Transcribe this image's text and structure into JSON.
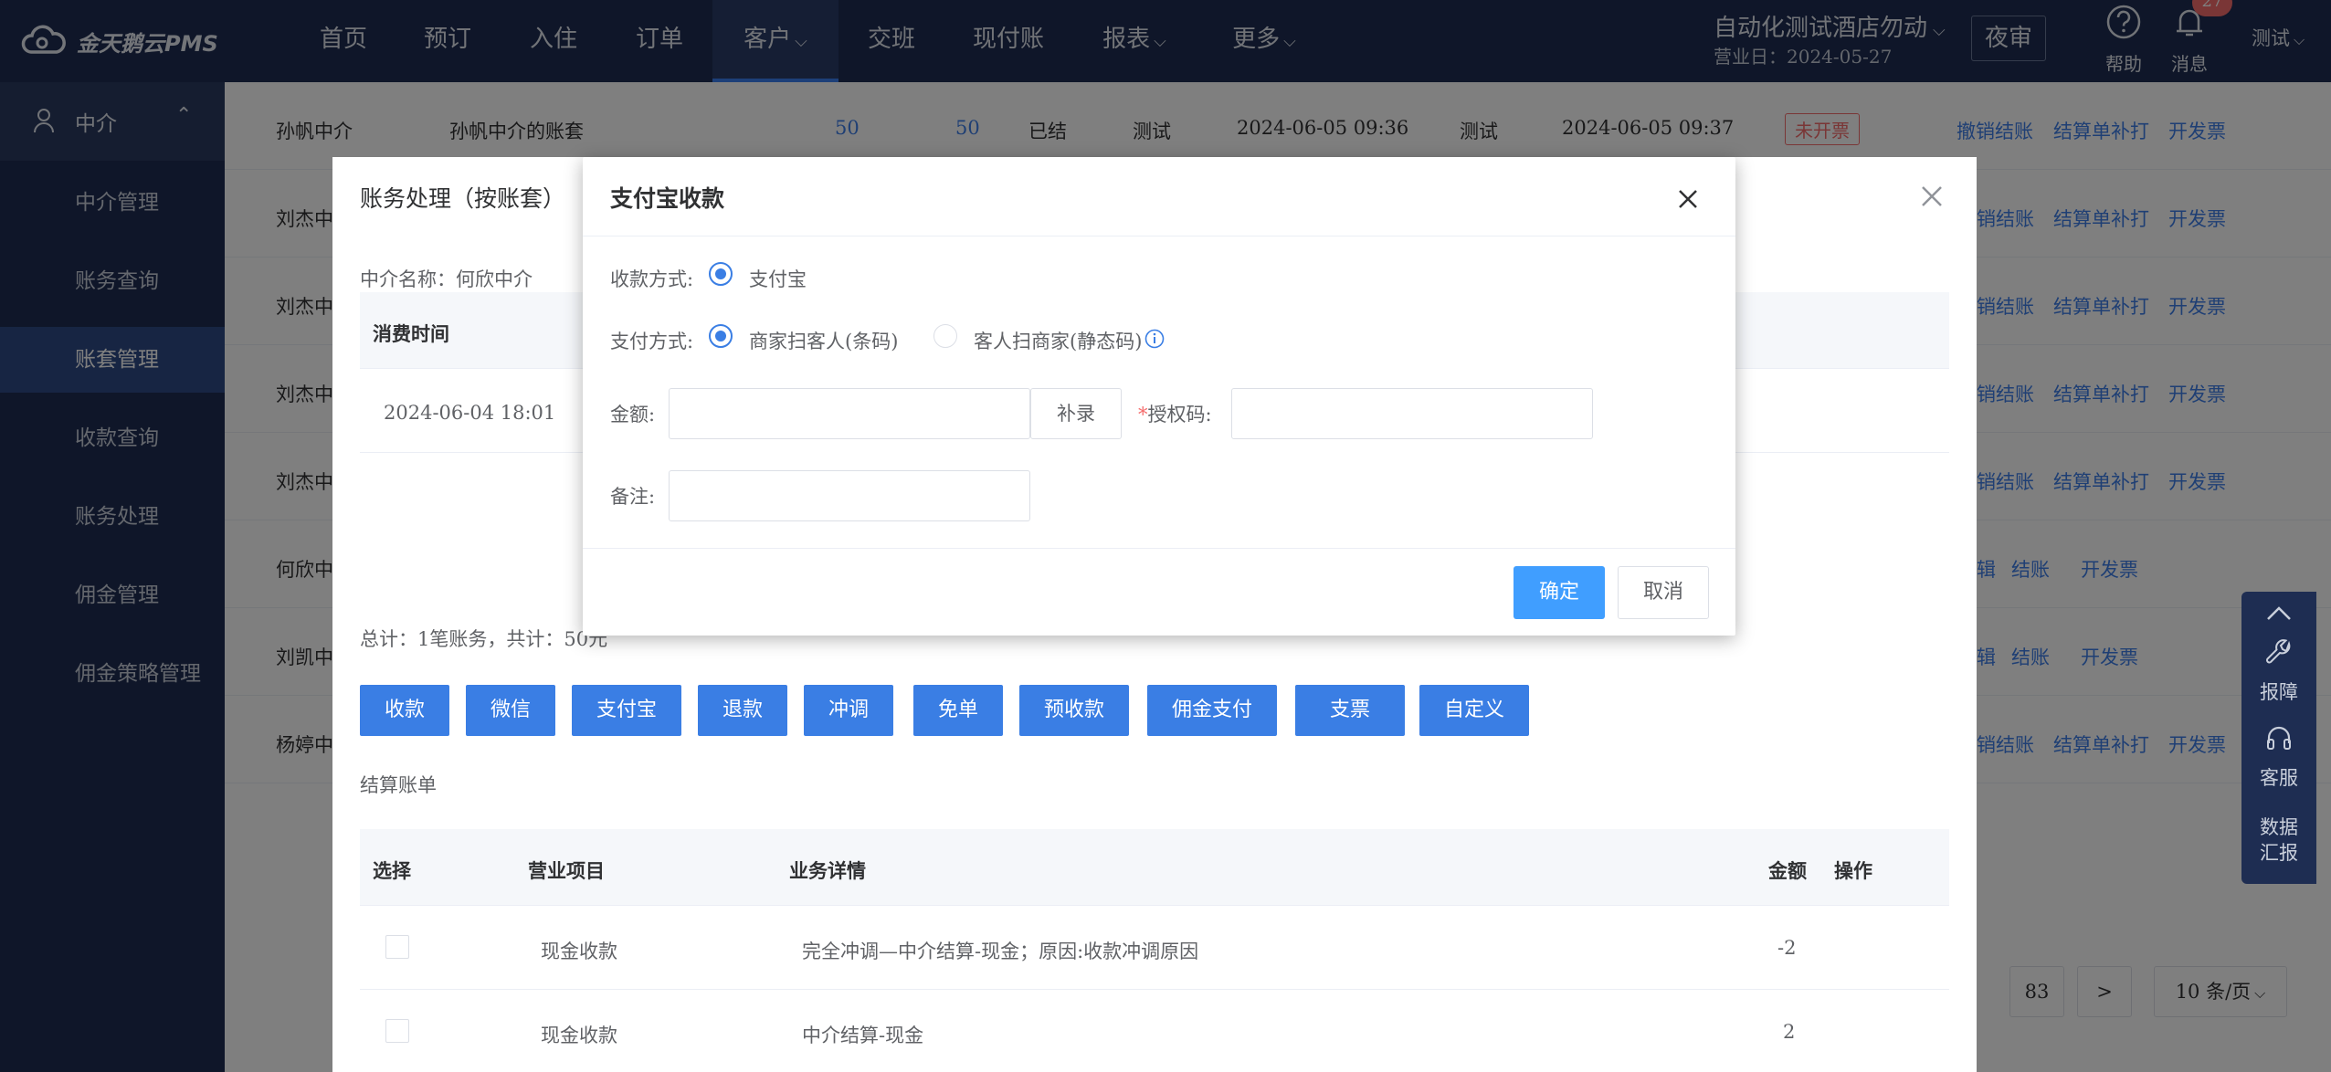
{
  "app": {
    "logo_text": "金天鹅云PMS"
  },
  "nav": {
    "items": [
      {
        "label": "首页"
      },
      {
        "label": "预订"
      },
      {
        "label": "入住"
      },
      {
        "label": "订单"
      },
      {
        "label": "客户"
      },
      {
        "label": "交班"
      },
      {
        "label": "现付账"
      },
      {
        "label": "报表"
      },
      {
        "label": "更多"
      }
    ],
    "hotel_name": "自动化测试酒店勿动",
    "business_day": "营业日：2024-05-27",
    "audit_button": "夜审",
    "help_label": "帮助",
    "message_label": "消息",
    "message_count": "27",
    "user": "测试"
  },
  "sidebar": {
    "section": "中介",
    "items": [
      {
        "label": "中介管理"
      },
      {
        "label": "账务查询"
      },
      {
        "label": "账套管理"
      },
      {
        "label": "收款查询"
      },
      {
        "label": "账务处理"
      },
      {
        "label": "佣金管理"
      },
      {
        "label": "佣金策略管理"
      }
    ],
    "active_index": 2
  },
  "background_table": {
    "first_row": {
      "agent": "孙帆中介",
      "account_set": "孙帆中介的账套",
      "v1": "50",
      "v2": "50",
      "status": "已结",
      "creator": "测试",
      "time1": "2024-06-05 09:36",
      "settler": "测试",
      "time2": "2024-06-05 09:37",
      "invoice_tag": "未开票"
    },
    "rows_agents": [
      "刘杰中",
      "刘杰中",
      "刘杰中",
      "刘杰中",
      "何欣中",
      "刘凯中",
      "杨婷中"
    ],
    "actions_a": [
      "销结账",
      "结算单补打",
      "开发票"
    ],
    "actions_b": [
      "辑",
      "结账",
      "开发票"
    ],
    "pagination": {
      "page": "83",
      "next": ">",
      "page_size": "10 条/页"
    }
  },
  "account_dialog": {
    "title": "账务处理（按账套）",
    "agent_label": "中介名称：何欣中介",
    "consume_header": "消费时间",
    "consume_row": "2024-06-04 18:01",
    "total": "总计：1笔账务，共计：50元",
    "action_buttons": [
      "收款",
      "微信",
      "支付宝",
      "退款",
      "冲调",
      "免单",
      "预收款",
      "佣金支付",
      "支票",
      "自定义"
    ],
    "settle_title": "结算账单",
    "settle_headers": {
      "select": "选择",
      "item": "营业项目",
      "detail": "业务详情",
      "amount": "金额",
      "op": "操作"
    },
    "settle_rows": [
      {
        "item": "现金收款",
        "detail": "完全冲调—中介结算-现金；原因:收款冲调原因",
        "amount": "-2"
      },
      {
        "item": "现金收款",
        "detail": "中介结算-现金",
        "amount": "2"
      }
    ]
  },
  "alipay_dialog": {
    "title": "支付宝收款",
    "method_label": "收款方式:",
    "method_value": "支付宝",
    "pay_type_label": "支付方式:",
    "pay_type_options": [
      "商家扫客人(条码)",
      "客人扫商家(静态码)"
    ],
    "amount_label": "金额:",
    "amount_value": "",
    "supplement_button": "补录",
    "auth_label": "授权码:",
    "auth_value": "",
    "remark_label": "备注:",
    "remark_value": "",
    "confirm": "确定",
    "cancel": "取消"
  },
  "float_panel": {
    "items": [
      "报障",
      "客服",
      "数据汇报"
    ]
  },
  "colors": {
    "nav_bg": "#1e2d52",
    "primary": "#409eff",
    "link": "#3e7fe9",
    "danger": "#f56c6c"
  }
}
